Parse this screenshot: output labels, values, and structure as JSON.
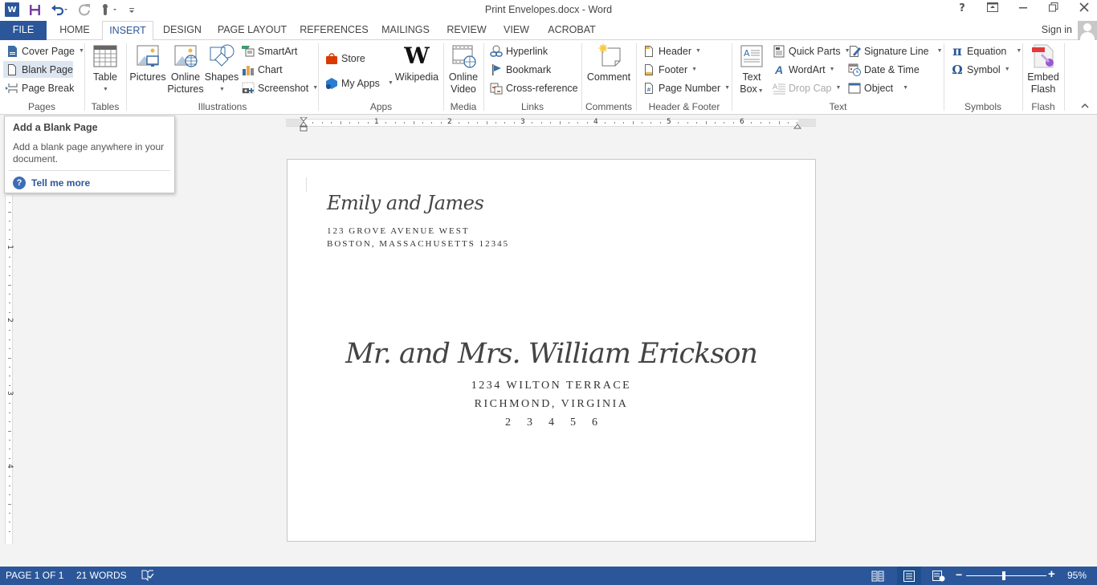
{
  "app": {
    "title": "Print Envelopes.docx - Word",
    "sign_in": "Sign in",
    "window_controls": [
      "help-icon",
      "ribbon-display-icon",
      "minimize-icon",
      "restore-icon",
      "close-icon"
    ]
  },
  "qat": {
    "icons": [
      "word-logo",
      "save-icon",
      "undo-icon",
      "redo-icon",
      "touch-mode-icon",
      "customize-qat-icon"
    ]
  },
  "tabs": [
    {
      "label": "FILE"
    },
    {
      "label": "HOME"
    },
    {
      "label": "INSERT",
      "active": true
    },
    {
      "label": "DESIGN"
    },
    {
      "label": "PAGE LAYOUT"
    },
    {
      "label": "REFERENCES"
    },
    {
      "label": "MAILINGS"
    },
    {
      "label": "REVIEW"
    },
    {
      "label": "VIEW"
    },
    {
      "label": "ACROBAT"
    }
  ],
  "ribbon": {
    "pages": {
      "label": "Pages",
      "cover_page": "Cover Page",
      "blank_page": "Blank Page",
      "page_break": "Page Break"
    },
    "tables": {
      "label": "Tables",
      "table": "Table"
    },
    "illustrations": {
      "label": "Illustrations",
      "pictures": "Pictures",
      "online_pictures_1": "Online",
      "online_pictures_2": "Pictures",
      "shapes": "Shapes",
      "smartart": "SmartArt",
      "chart": "Chart",
      "screenshot": "Screenshot"
    },
    "apps": {
      "label": "Apps",
      "store": "Store",
      "my_apps": "My Apps",
      "wikipedia": "Wikipedia"
    },
    "media": {
      "label": "Media",
      "online_video_1": "Online",
      "online_video_2": "Video"
    },
    "links": {
      "label": "Links",
      "hyperlink": "Hyperlink",
      "bookmark": "Bookmark",
      "cross_reference": "Cross-reference"
    },
    "comments": {
      "label": "Comments",
      "comment": "Comment"
    },
    "header_footer": {
      "label": "Header & Footer",
      "header": "Header",
      "footer": "Footer",
      "page_number": "Page Number"
    },
    "text": {
      "label": "Text",
      "text_box_1": "Text",
      "text_box_2": "Box",
      "quick_parts": "Quick Parts",
      "wordart": "WordArt",
      "drop_cap": "Drop Cap",
      "signature_line": "Signature Line",
      "date_time": "Date & Time",
      "object": "Object"
    },
    "symbols": {
      "label": "Symbols",
      "equation": "Equation",
      "symbol": "Symbol"
    },
    "flash": {
      "label": "Flash",
      "embed_flash_1": "Embed",
      "embed_flash_2": "Flash"
    }
  },
  "tooltip": {
    "title": "Add a Blank Page",
    "description": "Add a blank page anywhere in your document.",
    "tell_me_more": "Tell me more"
  },
  "ruler": {
    "horizontal_numbers": [
      "1",
      "2",
      "3",
      "4",
      "5",
      "6"
    ],
    "vertical_numbers": [
      "1",
      "2",
      "3",
      "4"
    ]
  },
  "document": {
    "return_name": "Emily and James",
    "return_address_1": "123 GROVE AVENUE WEST",
    "return_address_2": "BOSTON, MASSACHUSETTS 12345",
    "recipient_name": "Mr. and Mrs. William Erickson",
    "recipient_address_1": "1234 WILTON TERRACE",
    "recipient_address_2": "RICHMOND, VIRGINIA",
    "recipient_zip": "23456"
  },
  "statusbar": {
    "page": "PAGE 1 OF 1",
    "words": "21 WORDS",
    "zoom_level": "95%",
    "zoom_percent": 95,
    "views": [
      "read-mode",
      "print-layout",
      "web-layout"
    ],
    "active_view": "print-layout"
  },
  "colors": {
    "accent": "#2b579a",
    "selected_button": "#dde6f0"
  }
}
